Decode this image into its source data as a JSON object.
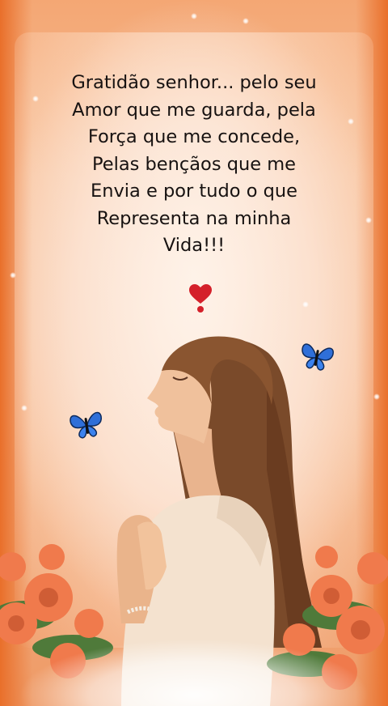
{
  "quote": {
    "text": "Gratidão senhor... pelo seu\nAmor que me guarda, pela\nForça que me concede,\n Pelas bençãos que me\nEnvia e por tudo o que\nRepresenta na minha\nVida!!!"
  },
  "icons": {
    "heart": "heart-exclamation-emoji",
    "butterfly": "blue-butterfly"
  },
  "colors": {
    "background": "#f5b488",
    "edge": "#e96f2a",
    "text": "#171211",
    "butterfly": "#2f6fd8",
    "rose": "#f07a4c",
    "heart": "#d4202a"
  }
}
